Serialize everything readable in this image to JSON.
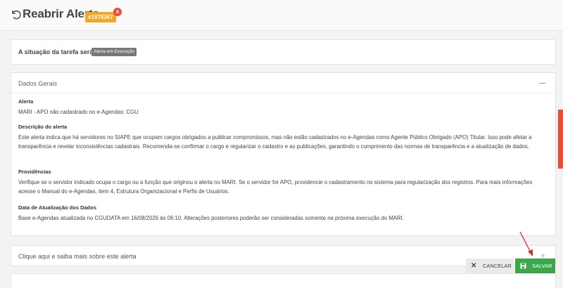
{
  "header": {
    "title": "Reabrir Alerta",
    "title_dash": "-",
    "alert_id": "#1978367",
    "close_badge": "x"
  },
  "situation": {
    "label": "A situação da tarefa será:",
    "status": "Alerta em Execução"
  },
  "dados_gerais": {
    "section_title": "Dados Gerais",
    "fields": [
      {
        "label": "Alerta",
        "value": "MARI - APO não cadastrado no e-Agendas: CGU"
      },
      {
        "label": "Descrição do alerta",
        "value": "Este alerta indica que há servidores no SIAPE que ocupam cargos obrigados a publicar compromissos, mas não estão cadastrados no e-Agendas como Agente Público Obrigado (APO) Titular. Isso pode afetar a transparência e revelar inconsistências cadastrais. Recomenda-se confirmar o cargo e regularizar o cadastro e as publicações, garantindo o cumprimento das normas de transparência e a atualização de dados."
      },
      {
        "label": "Providências",
        "value": "Verifique se o servidor indicado ocupa o cargo ou a função que originou o alerta no MARI. Se o servidor for APO, providencie o cadastramento no sistema para regularização dos registros. Para mais informações acesse o Manual do e-Agendas, item 4, Estrutura Organizacional e Perfis de Usuários."
      },
      {
        "label": "Data de Atualização dos Dados",
        "value": "Base e-Agendas atualizada no CGUDATA em 16/08/2026 às 06:10. Alterações posteriores poderão ser consideradas somente na próxima execução do MARI."
      }
    ]
  },
  "saiba_mais": {
    "text": "Clique aqui e saiba mais sobre este alerta"
  },
  "buttons": {
    "cancel": "CANCELAR",
    "save": "SALVAR"
  },
  "colors": {
    "badge": "#f5a623",
    "close": "#e74c3c",
    "save": "#3aa84a",
    "status": "#777777"
  },
  "icons": {
    "back": "undo-icon",
    "collapse": "minus-icon",
    "expand": "plus-icon",
    "cancel": "close-icon",
    "save": "floppy-icon"
  }
}
